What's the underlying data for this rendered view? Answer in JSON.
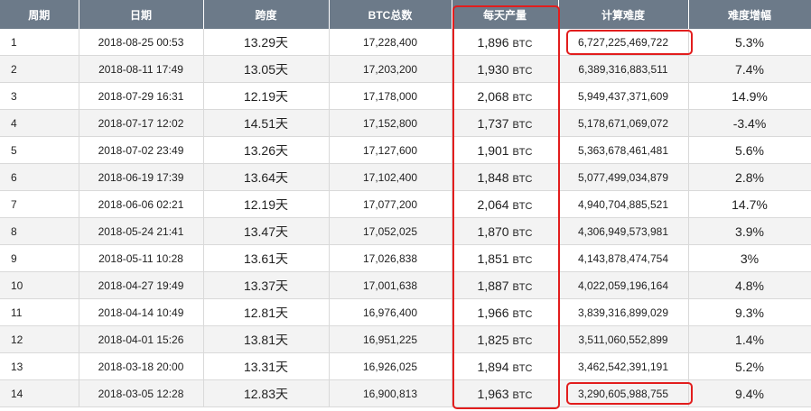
{
  "headers": [
    "周期",
    "日期",
    "跨度",
    "BTC总数",
    "每天产量",
    "计算难度",
    "难度增幅"
  ],
  "span_unit": "天",
  "daily_unit": "BTC",
  "rows": [
    {
      "week": "1",
      "date": "2018-08-25 00:53",
      "span": "13.29",
      "total": "17,228,400",
      "daily": "1,896",
      "difficulty": "6,727,225,469,722",
      "increase": "5.3%"
    },
    {
      "week": "2",
      "date": "2018-08-11 17:49",
      "span": "13.05",
      "total": "17,203,200",
      "daily": "1,930",
      "difficulty": "6,389,316,883,511",
      "increase": "7.4%"
    },
    {
      "week": "3",
      "date": "2018-07-29 16:31",
      "span": "12.19",
      "total": "17,178,000",
      "daily": "2,068",
      "difficulty": "5,949,437,371,609",
      "increase": "14.9%"
    },
    {
      "week": "4",
      "date": "2018-07-17 12:02",
      "span": "14.51",
      "total": "17,152,800",
      "daily": "1,737",
      "difficulty": "5,178,671,069,072",
      "increase": "-3.4%"
    },
    {
      "week": "5",
      "date": "2018-07-02 23:49",
      "span": "13.26",
      "total": "17,127,600",
      "daily": "1,901",
      "difficulty": "5,363,678,461,481",
      "increase": "5.6%"
    },
    {
      "week": "6",
      "date": "2018-06-19 17:39",
      "span": "13.64",
      "total": "17,102,400",
      "daily": "1,848",
      "difficulty": "5,077,499,034,879",
      "increase": "2.8%"
    },
    {
      "week": "7",
      "date": "2018-06-06 02:21",
      "span": "12.19",
      "total": "17,077,200",
      "daily": "2,064",
      "difficulty": "4,940,704,885,521",
      "increase": "14.7%"
    },
    {
      "week": "8",
      "date": "2018-05-24 21:41",
      "span": "13.47",
      "total": "17,052,025",
      "daily": "1,870",
      "difficulty": "4,306,949,573,981",
      "increase": "3.9%"
    },
    {
      "week": "9",
      "date": "2018-05-11 10:28",
      "span": "13.61",
      "total": "17,026,838",
      "daily": "1,851",
      "difficulty": "4,143,878,474,754",
      "increase": "3%"
    },
    {
      "week": "10",
      "date": "2018-04-27 19:49",
      "span": "13.37",
      "total": "17,001,638",
      "daily": "1,887",
      "difficulty": "4,022,059,196,164",
      "increase": "4.8%"
    },
    {
      "week": "11",
      "date": "2018-04-14 10:49",
      "span": "12.81",
      "total": "16,976,400",
      "daily": "1,966",
      "difficulty": "3,839,316,899,029",
      "increase": "9.3%"
    },
    {
      "week": "12",
      "date": "2018-04-01 15:26",
      "span": "13.81",
      "total": "16,951,225",
      "daily": "1,825",
      "difficulty": "3,511,060,552,899",
      "increase": "1.4%"
    },
    {
      "week": "13",
      "date": "2018-03-18 20:00",
      "span": "13.31",
      "total": "16,926,025",
      "daily": "1,894",
      "difficulty": "3,462,542,391,191",
      "increase": "5.2%"
    },
    {
      "week": "14",
      "date": "2018-03-05 12:28",
      "span": "12.83",
      "total": "16,900,813",
      "daily": "1,963",
      "difficulty": "3,290,605,988,755",
      "increase": "9.4%"
    }
  ],
  "colors": {
    "header_bg": "#6c7a89",
    "header_text": "#ffffff",
    "row_alt_bg": "#f3f3f3",
    "highlight": "#e21d1d"
  }
}
